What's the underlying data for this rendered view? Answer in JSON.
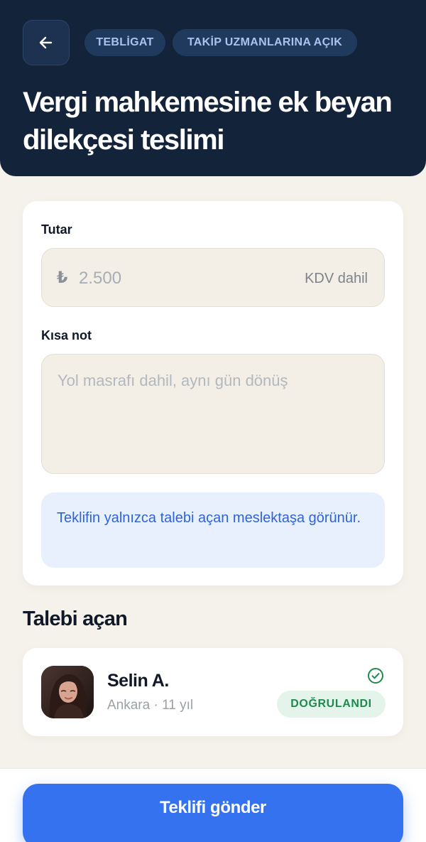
{
  "header": {
    "tags": [
      "TEBLİGAT",
      "TAKİP UZMANLARINA AÇIK"
    ],
    "title": "Vergi mahkemesine ek beyan dilekçesi teslimi"
  },
  "form": {
    "amount": {
      "label": "Tutar",
      "currency_symbol": "₺",
      "placeholder": "2.500",
      "value": "",
      "suffix": "KDV dahil"
    },
    "note": {
      "label": "Kısa not",
      "placeholder": "Yol masrafı dahil, aynı gün dönüş",
      "value": ""
    },
    "info": "Teklifin yalnızca talebi açan meslektaşa görünür."
  },
  "requester": {
    "section_title": "Talebi açan",
    "name": "Selin A.",
    "meta": "Ankara · 11 yıl",
    "badge": "DOĞRULANDI"
  },
  "footer": {
    "submit_label": "Teklifi gönder"
  },
  "icons": {
    "back": "arrow-left-icon",
    "verified": "check-circle-icon",
    "avatar": "user-photo"
  },
  "colors": {
    "header_bg": "#13233a",
    "page_bg": "#f5f2ec",
    "accent": "#3572ef",
    "info_text": "#2f63d8",
    "verified_green": "#1f8a4f"
  }
}
